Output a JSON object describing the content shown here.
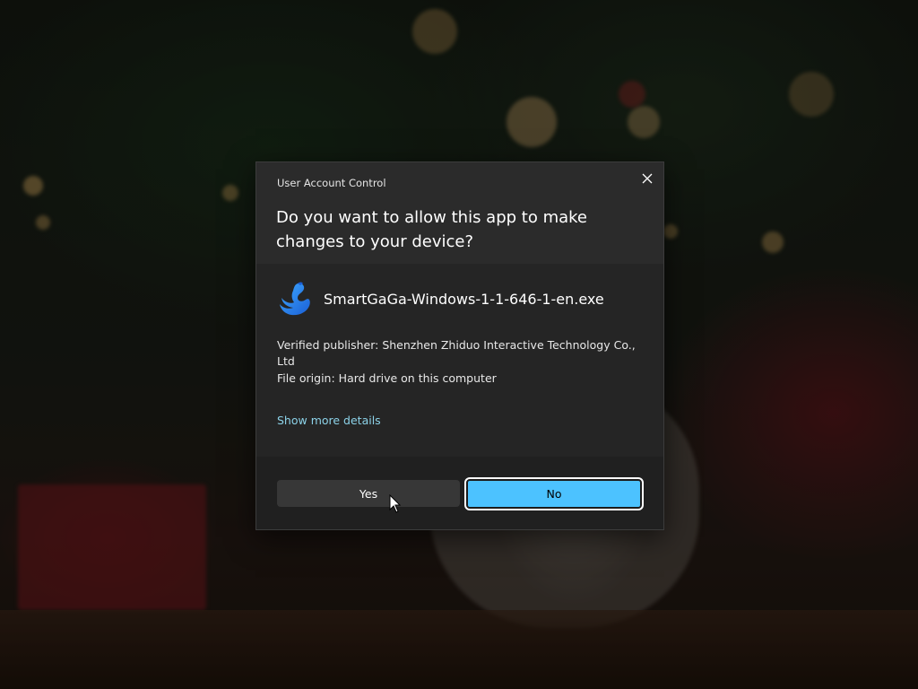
{
  "dialog": {
    "caption": "User Account Control",
    "question": "Do you want to allow this app to make changes to your device?",
    "app_name": "SmartGaGa-Windows-1-1-646-1-en.exe",
    "app_icon": "swan-logo-icon",
    "publisher": "Verified publisher: Shenzhen Zhiduo Interactive Technology Co., Ltd",
    "file_origin": "File origin: Hard drive on this computer",
    "more_details_link": "Show more details",
    "yes_label": "Yes",
    "no_label": "No"
  },
  "colors": {
    "dialog_bg": "#2b2b2b",
    "body_bg": "#252525",
    "footer_bg": "#202020",
    "accent": "#4cc2ff",
    "link": "#8cd2e8"
  }
}
